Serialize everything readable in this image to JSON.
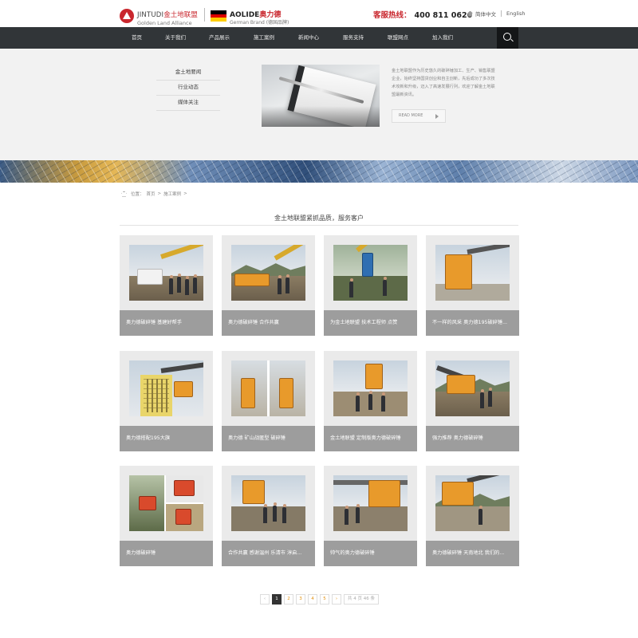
{
  "header": {
    "logo1_en": "JINTUDI",
    "logo1_cn": "金土地联盟",
    "logo1_sub": "Golden Land Alliance",
    "logo2_en": "AOLIDE",
    "logo2_cn": "奥力德",
    "logo2_sub": "German Brand (德国品牌)",
    "hotline_label": "客服热线：",
    "hotline_number": "400 811 0626",
    "lang_cn": "简体中文",
    "lang_en": "English"
  },
  "nav": {
    "items": [
      "首页",
      "关于我们",
      "产品展示",
      "施工案例",
      "新闻中心",
      "服务支持",
      "联盟网点",
      "加入我们"
    ]
  },
  "submenu": {
    "items": [
      "金土地要闻",
      "行业动态",
      "媒体关注"
    ]
  },
  "intro": {
    "text": "金土地联盟作为历史悠久的破碎锤加工、生产、销售联盟企业，始终坚持国货创业和自主创新，先后成功了多次技术攻新和升级，迈入了高速发展行列，欢迎了解金土地联盟最新资讯。",
    "read_more": "READ MORE"
  },
  "breadcrumb": {
    "prefix": "位置：",
    "home": "首页",
    "current": "施工案例",
    "sep": ">"
  },
  "section": {
    "title": "金土地联盟紧抓品质，服务客户"
  },
  "cases": [
    {
      "caption": "奥力德破碎锤 基建好帮手"
    },
    {
      "caption": "奥力德破碎锤 合作共赢"
    },
    {
      "caption": "为金土地联盟 技术工程师 点赞"
    },
    {
      "caption": "不一样的风采 奥力德195破碎锤..."
    },
    {
      "caption": "奥力德搭配195大旗"
    },
    {
      "caption": "奥力德 矿山战匿型 破碎锤"
    },
    {
      "caption": "金土地联盟 定制版奥力德破碎锤"
    },
    {
      "caption": "强力推荐 奥力德破碎锤"
    },
    {
      "caption": "奥力德破碎锤"
    },
    {
      "caption": "合作共赢 感谢温州 乐清市 淳启..."
    },
    {
      "caption": "帅气的奥力德破碎锤"
    },
    {
      "caption": "奥力德破碎锤 天南地北 我们的..."
    }
  ],
  "pagination": {
    "prev": "‹",
    "pages": [
      "1",
      "2",
      "3",
      "4",
      "5"
    ],
    "next": "›",
    "info": "共 4 页 46 条"
  },
  "colors": {
    "brand_red": "#c9272e",
    "nav_bg": "#313538",
    "caption_bg": "#9d9d9d",
    "accent_orange": "#e89a2b"
  }
}
